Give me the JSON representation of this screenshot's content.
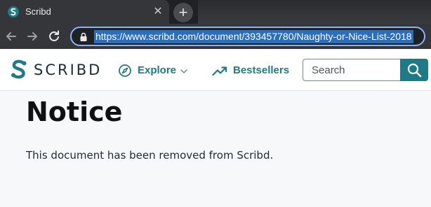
{
  "browser": {
    "tab": {
      "title": "Scribd",
      "favicon": "scribd-favicon",
      "close_glyph": "✕"
    },
    "new_tab_glyph": "+",
    "address_bar": {
      "url": "https://www.scribd.com/document/393457780/Naughty-or-Nice-List-2018",
      "secure_icon": "lock-icon"
    },
    "nav_icons": [
      "back-arrow-icon",
      "forward-arrow-icon",
      "reload-icon"
    ]
  },
  "site": {
    "logo_text": "SCRIBD",
    "nav": [
      {
        "label": "Explore",
        "icon": "compass-icon",
        "has_dropdown": true
      },
      {
        "label": "Bestsellers",
        "icon": "trending-up-icon"
      }
    ],
    "search": {
      "placeholder": "Search",
      "button_icon": "search-icon"
    },
    "brand_color": "#1e7b85"
  },
  "notice": {
    "title": "Notice",
    "message": "This document has been removed from Scribd."
  }
}
